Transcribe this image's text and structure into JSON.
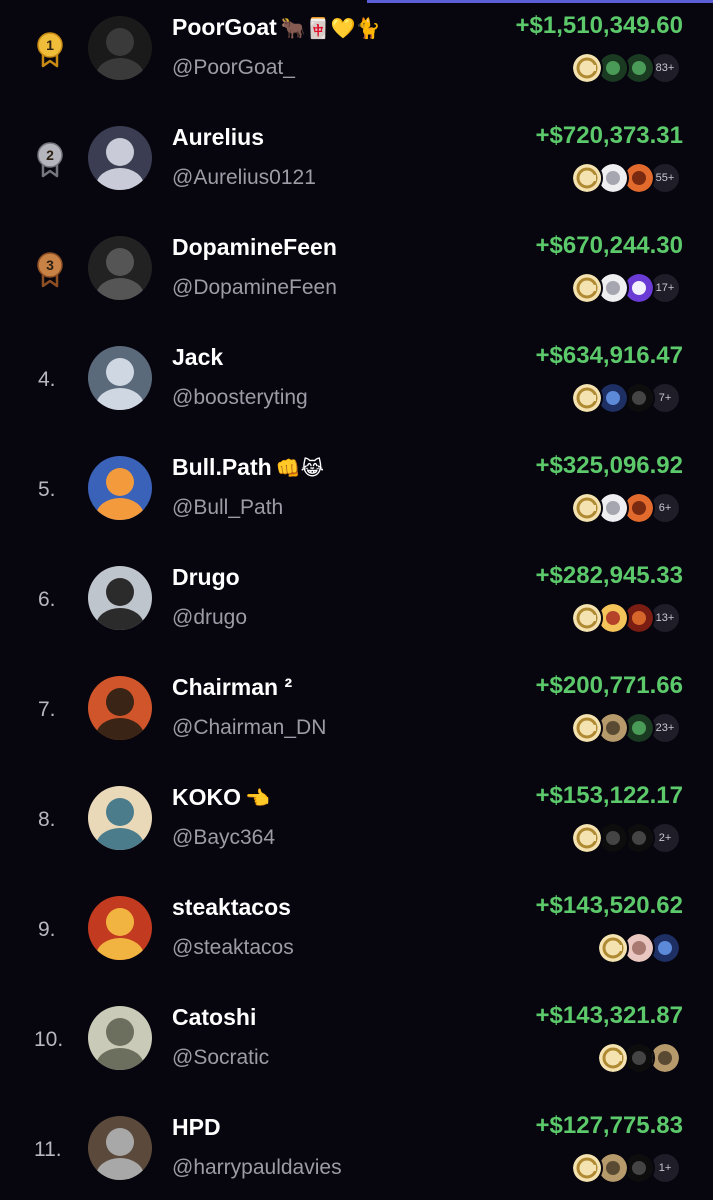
{
  "colors": {
    "background": "#07060f",
    "positive": "#5cc96b",
    "accent": "#5b5fd6",
    "gold": "#e0a92c",
    "silver": "#9e9ea6",
    "bronze": "#b8703a"
  },
  "leaderboard": [
    {
      "rank": "1",
      "medal": "gold",
      "name": "PoorGoat",
      "badges": "🐂🀄💛🐈",
      "handle": "@PoorGoat_",
      "pnl": "+$1,510,349.60",
      "token_count": "83+",
      "tokens": [
        "coin-icon",
        "green-token-icon",
        "green-token-icon"
      ]
    },
    {
      "rank": "2",
      "medal": "silver",
      "name": "Aurelius",
      "badges": "",
      "handle": "@Aurelius0121",
      "pnl": "+$720,373.31",
      "token_count": "55+",
      "tokens": [
        "coin-icon",
        "white-token-icon",
        "orange-token-icon"
      ]
    },
    {
      "rank": "3",
      "medal": "bronze",
      "name": "DopamineFeen",
      "badges": "",
      "handle": "@DopamineFeen",
      "pnl": "+$670,244.30",
      "token_count": "17+",
      "tokens": [
        "coin-icon",
        "white-token-icon",
        "purple-token-icon"
      ]
    },
    {
      "rank": "4.",
      "medal": "",
      "name": "Jack",
      "badges": "",
      "handle": "@boosteryting",
      "pnl": "+$634,916.47",
      "token_count": "7+",
      "tokens": [
        "coin-icon",
        "blue-token-icon",
        "dark-token-icon"
      ]
    },
    {
      "rank": "5.",
      "medal": "",
      "name": "Bull.Path",
      "badges": "👊😹",
      "handle": "@Bull_Path",
      "pnl": "+$325,096.92",
      "token_count": "6+",
      "tokens": [
        "coin-icon",
        "white-token-icon",
        "orange-token-icon"
      ]
    },
    {
      "rank": "6.",
      "medal": "",
      "name": "Drugo",
      "badges": "",
      "handle": "@drugo",
      "pnl": "+$282,945.33",
      "token_count": "13+",
      "tokens": [
        "coin-icon",
        "pizza-token-icon",
        "red-token-icon"
      ]
    },
    {
      "rank": "7.",
      "medal": "",
      "name": "Chairman ²",
      "badges": "",
      "handle": "@Chairman_DN",
      "pnl": "+$200,771.66",
      "token_count": "23+",
      "tokens": [
        "coin-icon",
        "tan-token-icon",
        "green-token-icon"
      ]
    },
    {
      "rank": "8.",
      "medal": "",
      "name": "KOKO",
      "badges": "👈",
      "handle": "@Bayc364",
      "pnl": "+$153,122.17",
      "token_count": "2+",
      "tokens": [
        "coin-icon",
        "dark-token-icon",
        "dark-token-icon"
      ]
    },
    {
      "rank": "9.",
      "medal": "",
      "name": "steaktacos",
      "badges": "",
      "handle": "@steaktacos",
      "pnl": "+$143,520.62",
      "token_count": "",
      "tokens": [
        "coin-icon",
        "pink-token-icon",
        "blue-token-icon"
      ]
    },
    {
      "rank": "10.",
      "medal": "",
      "name": "Catoshi",
      "badges": "",
      "handle": "@Socratic",
      "pnl": "+$143,321.87",
      "token_count": "",
      "tokens": [
        "coin-icon",
        "dark-token-icon",
        "tan-token-icon"
      ]
    },
    {
      "rank": "11.",
      "medal": "",
      "name": "HPD",
      "badges": "",
      "handle": "@harrypauldavies",
      "pnl": "+$127,775.83",
      "token_count": "1+",
      "tokens": [
        "coin-icon",
        "tan-token-icon",
        "dark-token-icon"
      ]
    }
  ]
}
